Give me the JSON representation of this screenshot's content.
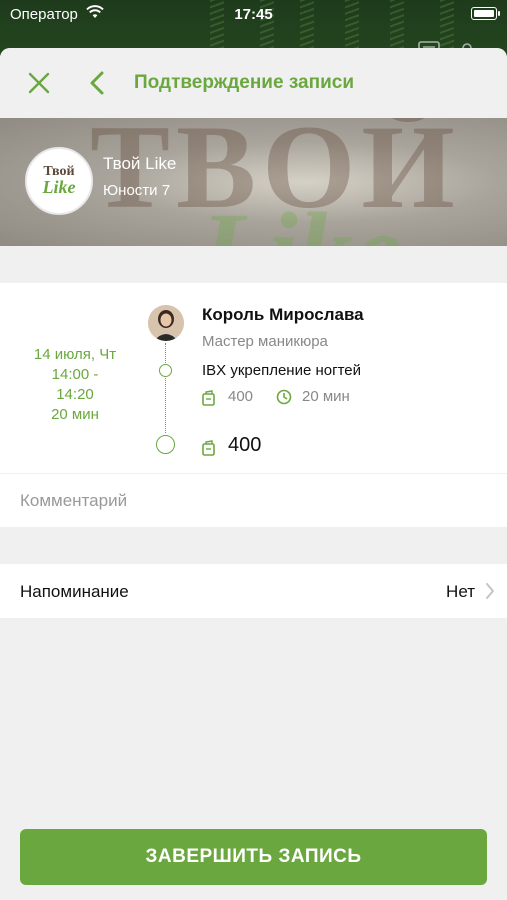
{
  "status_bar": {
    "carrier": "Оператор",
    "time": "17:45"
  },
  "nav": {
    "title": "Подтверждение записи"
  },
  "salon": {
    "name": "Твой Like",
    "address": "Юности 7",
    "logo_text_top": "Твой",
    "logo_text_bottom": "Like",
    "banner_text_top": "ТВОЙ",
    "banner_text_bottom": "Like"
  },
  "booking": {
    "date": "14 июля, Чт",
    "time_start": "14:00 -",
    "time_end": "14:20",
    "duration": "20 мин",
    "master_name": "Король Мирослава",
    "master_role": "Мастер маникюра",
    "service_name": "IBX укрепление ногтей",
    "service_price": "400",
    "service_duration": "20 мин",
    "total": "400"
  },
  "comment": {
    "placeholder": "Комментарий"
  },
  "reminder": {
    "label": "Напоминание",
    "value": "Нет"
  },
  "finish_button": {
    "label": "ЗАВЕРШИТЬ ЗАПИСЬ"
  },
  "colors": {
    "accent": "#6aa83f",
    "background": "#f0f0f0"
  }
}
